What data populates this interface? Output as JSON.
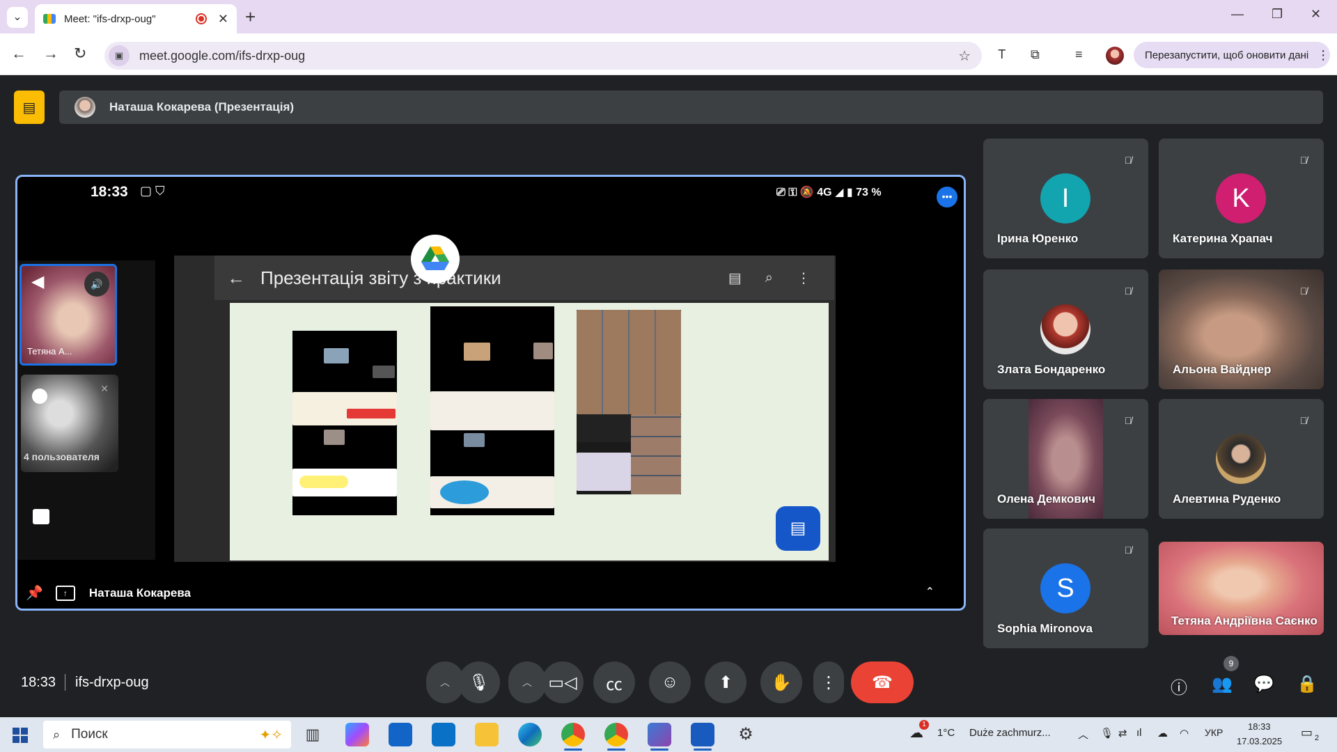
{
  "browser": {
    "tab_title": "Meet: \"ifs-drxp-oug\"",
    "tab_close": "✕",
    "new_tab": "+",
    "url": "meet.google.com/ifs-drxp-oug",
    "relaunch_label": "Перезапустити, щоб оновити дані"
  },
  "meet": {
    "presenter_label": "Наташа Кокарева (Презентація)",
    "stage": {
      "status_time": "18:33",
      "battery": "73 %",
      "network": "4G",
      "slide_title": "Презентація звіту з практики",
      "pip_label_1": "Тетяна А...",
      "pip_label_2": "4 пользователя",
      "presenter_name": "Наташа Кокарева"
    },
    "participants": [
      {
        "name": "Ірина Юренко",
        "initial": "I",
        "color": "#12a4af",
        "kind": "letter"
      },
      {
        "name": "Катерина Храпач",
        "initial": "K",
        "color": "#d01e71",
        "kind": "letter"
      },
      {
        "name": "Злата Бондаренко",
        "kind": "photo"
      },
      {
        "name": "Альона Вайднер",
        "kind": "video"
      },
      {
        "name": "Олена Демкович",
        "kind": "video"
      },
      {
        "name": "Алевтина Руденко",
        "kind": "photo"
      },
      {
        "name": "Sophia Mironova",
        "initial": "S",
        "color": "#1a73e8",
        "kind": "letter"
      },
      {
        "name": "Тетяна Андріївна Саєнко",
        "display": "Тетяна Андріївна Саєнко",
        "kind": "video"
      }
    ],
    "bottom": {
      "time": "18:33",
      "meeting_code": "ifs-drxp-oug",
      "people_count": "9"
    }
  },
  "taskbar": {
    "search_placeholder": "Поиск",
    "weather": "1°C",
    "weather_text": "Duże zachmurz...",
    "lang": "УКР",
    "time": "18:33",
    "date": "17.03.2025",
    "notif_count": "2",
    "weather_badge": "1"
  }
}
